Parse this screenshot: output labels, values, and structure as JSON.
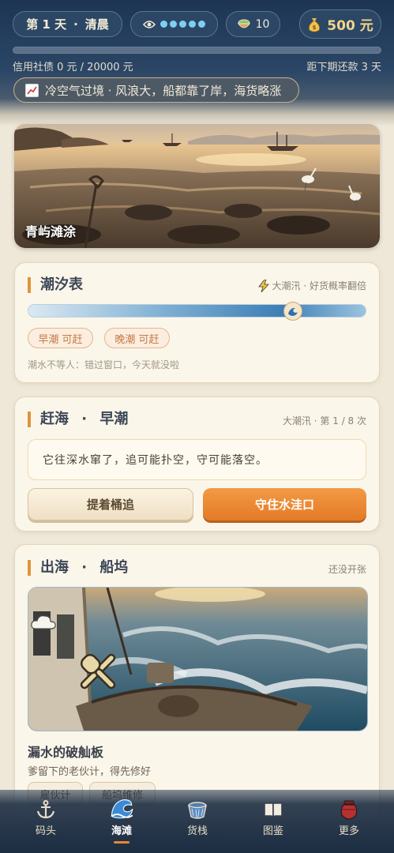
{
  "status": {
    "day_label": "第 1 天",
    "dot": "·",
    "time_of_day": "清晨",
    "stamina_dots": 5,
    "bait_count": "10",
    "money": "500 元"
  },
  "debt": {
    "text": "信用社债 0 元 / 20000 元",
    "progress": 0,
    "due_text": "距下期还款 3 天"
  },
  "news": {
    "icon": "trend-chart-icon",
    "text": "冷空气过境 · 风浪大，船都靠了岸，海货略涨"
  },
  "location": {
    "name": "青屿滩涂"
  },
  "tide": {
    "title": "潮汐表",
    "meta_icon": "lightning-icon",
    "meta": "大潮汛 · 好货概率翻倍",
    "progress": 0.78,
    "chips": [
      "早潮 可赶",
      "晚潮 可赶"
    ],
    "note": "潮水不等人：错过窗口，今天就没啦"
  },
  "foraging": {
    "title_a": "赶海",
    "title_b": "早潮",
    "meta": "大潮汛 · 第 1 / 8 次",
    "message": "它往深水窜了，追可能扑空，守可能落空。",
    "btn_chase": "提着桶追",
    "btn_guard": "守住水洼口"
  },
  "sailing": {
    "title_a": "出海",
    "title_b": "船坞",
    "meta": "还没开张",
    "boat_name": "漏水的破舢板",
    "boat_desc": "爹留下的老伙计，得先修好",
    "tags": [
      "雇伙计",
      "船坞维修"
    ]
  },
  "nav": {
    "items": [
      {
        "label": "码头",
        "icon": "anchor-icon"
      },
      {
        "label": "海滩",
        "icon": "wave-icon"
      },
      {
        "label": "货栈",
        "icon": "basket-icon"
      },
      {
        "label": "图鉴",
        "icon": "book-icon"
      },
      {
        "label": "更多",
        "icon": "jar-icon"
      }
    ],
    "active": 1
  },
  "colors": {
    "accent": "#e8872e",
    "header_bg": "#1d3553",
    "card_bg": "#fbf6ea"
  }
}
